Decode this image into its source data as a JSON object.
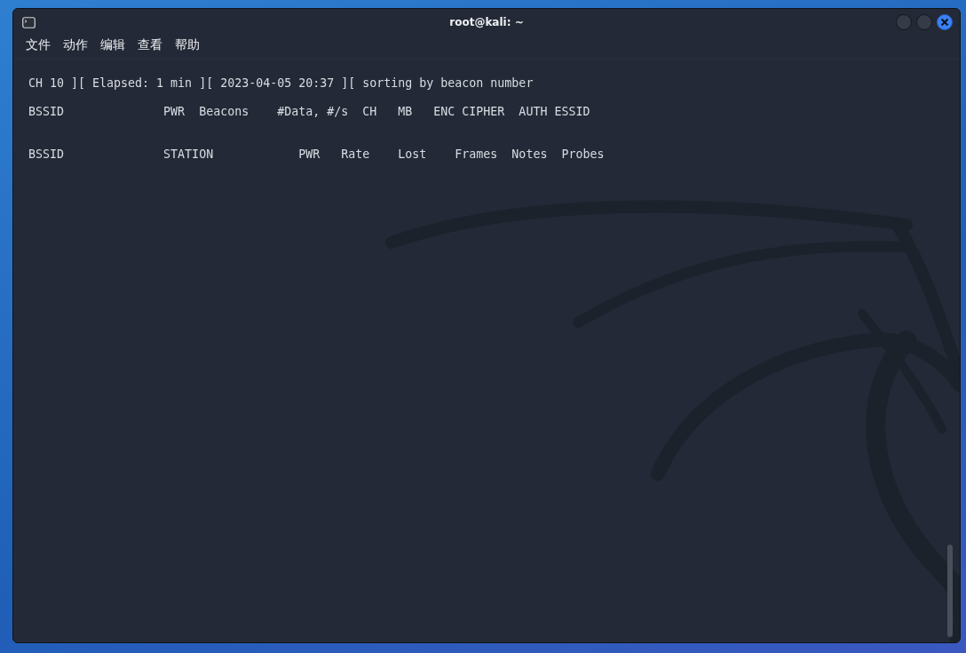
{
  "window": {
    "title": "root@kali: ~"
  },
  "menu": [
    "文件",
    "动作",
    "编辑",
    "查看",
    "帮助"
  ],
  "terminal": {
    "lines": [
      "CH 10 ][ Elapsed: 1 min ][ 2023-04-05 20:37 ][ sorting by beacon number",
      "BSSID              PWR  Beacons    #Data, #/s  CH   MB   ENC CIPHER  AUTH ESSID",
      "BSSID              STATION            PWR   Rate    Lost    Frames  Notes  Probes"
    ]
  }
}
